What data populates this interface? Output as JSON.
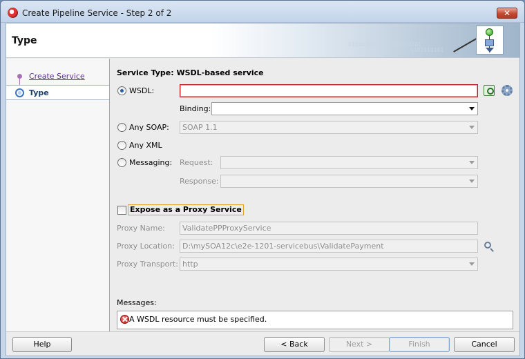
{
  "window": {
    "title": "Create Pipeline Service - Step 2 of 2",
    "close_symbol": "✕"
  },
  "header": {
    "title": "Type",
    "binary_text_1": "0101010101010101010101",
    "binary_text_2": "0101010101"
  },
  "nav": {
    "items": [
      {
        "label": "Create Service",
        "state": "visited"
      },
      {
        "label": "Type",
        "state": "current"
      }
    ]
  },
  "main": {
    "section_title": "Service Type: WSDL-based service",
    "wsdl": {
      "label": "WSDL:",
      "value": "",
      "selected": true,
      "binding_label": "Binding:",
      "binding_value": ""
    },
    "any_soap": {
      "label": "Any SOAP:",
      "value": "SOAP 1.1"
    },
    "any_xml": {
      "label": "Any XML"
    },
    "messaging": {
      "label": "Messaging:",
      "request_label": "Request:",
      "request_value": "",
      "response_label": "Response:",
      "response_value": ""
    },
    "proxy": {
      "checkbox_label": "Expose as a Proxy Service",
      "checked": false,
      "name_label": "Proxy Name:",
      "name_value": "ValidatePPProxyService",
      "location_label": "Proxy Location:",
      "location_value": "D:\\mySOA12c\\e2e-1201-servicebus\\ValidatePayment",
      "transport_label": "Proxy Transport:",
      "transport_value": "http"
    },
    "messages": {
      "label": "Messages:",
      "error_text": "A WSDL resource must be specified."
    }
  },
  "footer": {
    "help": "Help",
    "back": "< Back",
    "next": "Next >",
    "finish": "Finish",
    "cancel": "Cancel"
  },
  "colors": {
    "error_border": "#b41e1e",
    "link": "#5b2f8a",
    "focus_outline": "#e6a326"
  }
}
